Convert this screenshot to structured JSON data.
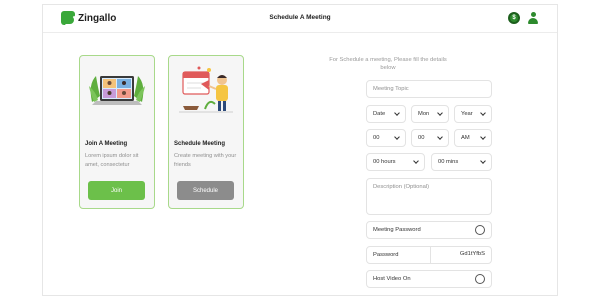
{
  "app": {
    "name": "Zingallo"
  },
  "header": {
    "title": "Schedule A Meeting",
    "coin_icon": "coin-icon",
    "user_icon": "user-icon"
  },
  "cards": {
    "join": {
      "title": "Join A Meeting",
      "description": "Lorem ipsum dolor sit amet, consectetur",
      "button": "Join",
      "illustration": "video-conference-laptop-illustration"
    },
    "schedule": {
      "title": "Schedule Meeting",
      "description": "Create meeting with your friends",
      "button": "Schedule",
      "illustration": "person-scheduling-illustration"
    }
  },
  "form": {
    "intro": "For Schedule a meeting, Please fill the details below",
    "topic_placeholder": "Meeting Topic",
    "date": {
      "day": "Date",
      "month": "Mon",
      "year": "Year"
    },
    "time": {
      "hour": "00",
      "minute": "00",
      "ampm": "AM"
    },
    "duration": {
      "hours": "00 hours",
      "mins": "00 mins"
    },
    "description_placeholder": "Description (Optional)",
    "meeting_password_label": "Meeting Password",
    "password_label": "Password",
    "password_value": "Gd1tYfbS",
    "host_video_label": "Host Video On"
  },
  "colors": {
    "accent": "#6cc04a",
    "brand": "#2d8a2d",
    "card_border": "#a8d98a",
    "schedule_button": "#8c8c8c"
  }
}
